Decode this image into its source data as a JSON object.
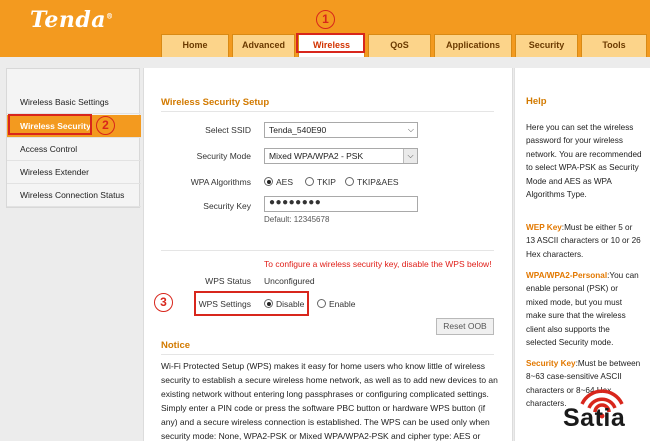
{
  "brand": {
    "logo": "Tenda",
    "reg": "®"
  },
  "nav": {
    "tabs": [
      {
        "label": "Home"
      },
      {
        "label": "Advanced"
      },
      {
        "label": "Wireless"
      },
      {
        "label": "QoS"
      },
      {
        "label": "Applications"
      },
      {
        "label": "Security"
      },
      {
        "label": "Tools"
      }
    ]
  },
  "annotations": {
    "step1": "1",
    "step2": "2",
    "step3": "3"
  },
  "sidebar": {
    "items": [
      {
        "label": "Wireless Basic Settings"
      },
      {
        "label": "Wireless Security"
      },
      {
        "label": "Access Control"
      },
      {
        "label": "Wireless Extender"
      },
      {
        "label": "Wireless Connection Status"
      }
    ]
  },
  "setup": {
    "title": "Wireless Security Setup",
    "ssid_label": "Select SSID",
    "ssid_value": "Tenda_540E90",
    "mode_label": "Security Mode",
    "mode_value": "Mixed WPA/WPA2 - PSK",
    "alg_label": "WPA Algorithms",
    "alg_aes": "AES",
    "alg_tkip": "TKIP",
    "alg_both": "TKIP&AES",
    "key_label": "Security Key",
    "key_value": "●●●●●●●●",
    "key_default": "Default: 12345678"
  },
  "wps": {
    "warning": "To configure a wireless security key, disable the WPS below!",
    "status_label": "WPS Status",
    "status_value": "Unconfigured",
    "settings_label": "WPS Settings",
    "disable": "Disable",
    "enable": "Enable",
    "reset": "Reset OOB"
  },
  "notice": {
    "title": "Notice",
    "lines": [
      "Wi-Fi Protected Setup (WPS) makes it easy for home users who know little of wireless",
      "security to establish a secure wireless home network, as well as to add new devices to an",
      "existing network without entering long passphrases or configuring complicated settings.",
      "Simply enter a PIN code or press the software PBC button or hardware WPS button (if",
      "any) and a secure wireless connection is established. The WPS can be used only when",
      "security mode: None, WPA2-PSK or Mixed WPA/WPA2-PSK and cipher type: AES or"
    ]
  },
  "help": {
    "title": "Help",
    "intro": "Here you can set the wireless password for your wireless network. You are recommended to select WPA-PSK as Security Mode and AES as WPA Algorithms Type.",
    "wep_key": "WEP Key",
    "wep_text": ":Must be either 5 or 13 ASCII characters or 10 or 26 Hex characters.",
    "wpa_key": "WPA/WPA2-Personal",
    "wpa_text": ":You can enable personal (PSK) or mixed mode, but you must make sure that the wireless client also supports the selected Security mode.",
    "sec_key": "Security Key",
    "sec_text": ":Must be between 8~63 case-sensitive ASCII characters or 8~64 Hex characters."
  },
  "watermark": {
    "text": "Satia"
  },
  "colors": {
    "brand": "#f39a1f",
    "accent": "#d27a00",
    "highlight": "#d8261c",
    "warning": "#e0201a"
  }
}
